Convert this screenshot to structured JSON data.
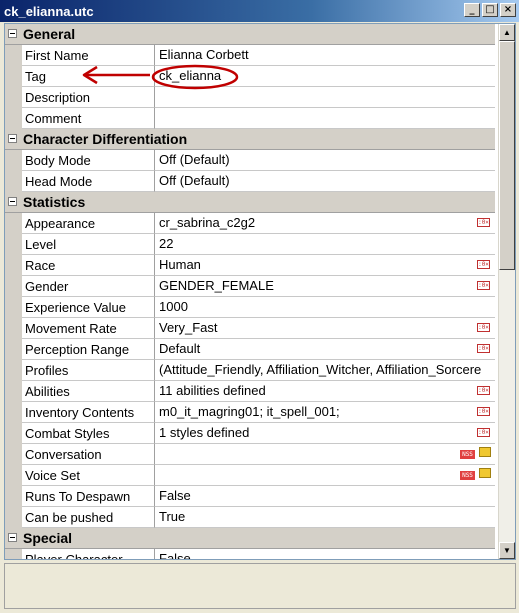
{
  "window": {
    "title": "ck_elianna.utc"
  },
  "controls": {
    "minimize": "_",
    "maximize": "□",
    "close": "×"
  },
  "scrollbar": {
    "up_arrow": "▲",
    "down_arrow": "▼"
  },
  "icons": {
    "edit": ":0×",
    "reference": "NSS"
  },
  "categories": {
    "general": "General",
    "char_diff": "Character Differentiation",
    "statistics": "Statistics",
    "special": "Special"
  },
  "general": [
    {
      "name": "First Name",
      "value": "Elianna Corbett"
    },
    {
      "name": "Tag",
      "value": "ck_elianna"
    },
    {
      "name": "Description",
      "value": ""
    },
    {
      "name": "Comment",
      "value": ""
    }
  ],
  "char_diff": [
    {
      "name": "Body Mode",
      "value": "Off (Default)"
    },
    {
      "name": "Head Mode",
      "value": "Off (Default)"
    }
  ],
  "statistics": [
    {
      "name": "Appearance",
      "value": "cr_sabrina_c2g2"
    },
    {
      "name": "Level",
      "value": "22"
    },
    {
      "name": "Race",
      "value": "Human"
    },
    {
      "name": "Gender",
      "value": "GENDER_FEMALE"
    },
    {
      "name": "Experience Value",
      "value": "1000"
    },
    {
      "name": "Movement Rate",
      "value": "Very_Fast"
    },
    {
      "name": "Perception Range",
      "value": "Default"
    },
    {
      "name": "Profiles",
      "value": "(Attitude_Friendly, Affiliation_Witcher, Affiliation_Sorcere"
    },
    {
      "name": "Abilities",
      "value": "11 abilities defined"
    },
    {
      "name": "Inventory Contents",
      "value": "m0_it_magring01; it_spell_001;"
    },
    {
      "name": "Combat Styles",
      "value": "1 styles defined"
    },
    {
      "name": "Conversation",
      "value": ""
    },
    {
      "name": "Voice Set",
      "value": ""
    },
    {
      "name": "Runs To Despawn",
      "value": "False"
    },
    {
      "name": "Can be pushed",
      "value": "True"
    }
  ],
  "special": [
    {
      "name": "Player Character",
      "value": "False"
    }
  ],
  "colors": {
    "title_start": "#0a246a",
    "title_end": "#a6caf0",
    "annotation": "#c00000"
  }
}
